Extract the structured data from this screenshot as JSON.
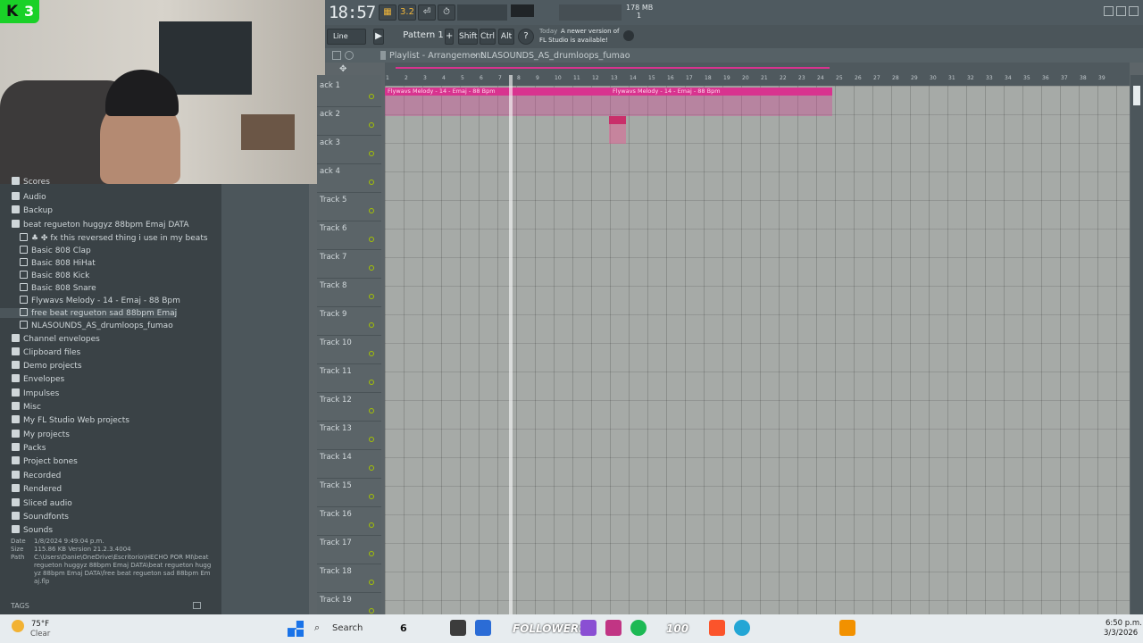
{
  "stream": {
    "badge_letter": "K",
    "badge_count": "3"
  },
  "topbar": {
    "time": "18:57",
    "memory": "178 MB",
    "memory_sub": "1",
    "pattern": "Pattern 1",
    "line_mode": "Line",
    "shift": "Shift",
    "ctrl": "Ctrl",
    "alt": "Alt",
    "notice_today": "Today",
    "notice_text": "A newer version of",
    "notice_text2": "FL Studio is available!"
  },
  "playlist": {
    "title": "Playlist - Arrangement",
    "sep": "›",
    "pattern_name": "NLASOUNDS_AS_drumloops_fumao",
    "ruler": [
      "1",
      "2",
      "3",
      "4",
      "5",
      "6",
      "7",
      "8",
      "9",
      "10",
      "11",
      "12",
      "13",
      "14",
      "15",
      "16",
      "17",
      "18",
      "19",
      "20",
      "21",
      "22",
      "23",
      "24",
      "25",
      "26",
      "27",
      "28",
      "29",
      "30",
      "31",
      "32",
      "33",
      "34",
      "35",
      "36",
      "37",
      "38",
      "39"
    ],
    "tracks": [
      "ack 1",
      "ack 2",
      "ack 3",
      "ack 4",
      "Track 5",
      "Track 6",
      "Track 7",
      "Track 8",
      "Track 9",
      "Track 10",
      "Track 11",
      "Track 12",
      "Track 13",
      "Track 14",
      "Track 15",
      "Track 16",
      "Track 17",
      "Track 18",
      "Track 19"
    ],
    "clip_label": "Flywavs Melody - 14 - Emaj - 88 Bpm"
  },
  "browser": {
    "items": [
      {
        "label": "Scores",
        "sub": false
      },
      {
        "label": "Audio",
        "sub": false
      },
      {
        "label": "Backup",
        "sub": false
      },
      {
        "label": "beat regueton huggyz 88bpm Emaj DATA",
        "sub": false
      },
      {
        "label": "♣ ✤ fx this reversed thing i use in my beats",
        "sub": true
      },
      {
        "label": "Basic 808 Clap",
        "sub": true
      },
      {
        "label": "Basic 808 HiHat",
        "sub": true
      },
      {
        "label": "Basic 808 Kick",
        "sub": true
      },
      {
        "label": "Basic 808 Snare",
        "sub": true
      },
      {
        "label": "Flywavs Melody - 14 - Emaj - 88 Bpm",
        "sub": true
      },
      {
        "label": "free beat regueton sad 88bpm Emaj",
        "sub": true
      },
      {
        "label": "NLASOUNDS_AS_drumloops_fumao",
        "sub": true
      },
      {
        "label": "Channel envelopes",
        "sub": false
      },
      {
        "label": "Clipboard files",
        "sub": false
      },
      {
        "label": "Demo projects",
        "sub": false
      },
      {
        "label": "Envelopes",
        "sub": false
      },
      {
        "label": "Impulses",
        "sub": false
      },
      {
        "label": "Misc",
        "sub": false
      },
      {
        "label": "My FL Studio Web projects",
        "sub": false
      },
      {
        "label": "My projects",
        "sub": false
      },
      {
        "label": "Packs",
        "sub": false
      },
      {
        "label": "Project bones",
        "sub": false
      },
      {
        "label": "Recorded",
        "sub": false
      },
      {
        "label": "Rendered",
        "sub": false
      },
      {
        "label": "Sliced audio",
        "sub": false
      },
      {
        "label": "Soundfonts",
        "sub": false
      },
      {
        "label": "Sounds",
        "sub": false
      }
    ],
    "info_date_label": "Date",
    "info_date": "1/8/2024 9:49:04 p.m.",
    "info_size_label": "Size",
    "info_size": "115.86 KB  Version 21.2.3.4004",
    "info_path_label": "Path",
    "info_path": "C:\\Users\\Danie\\OneDrive\\Escritorio\\HECHO POR MI\\beat regueton huggyz 88bpm Emaj DATA\\beat regueton huggyz 88bpm Emaj DATA\\free beat regueton sad 88bpm Emaj.flp",
    "tags": "TAGS"
  },
  "taskbar": {
    "temp": "75°F",
    "weather": "Clear",
    "search": "Search",
    "followers": "FOLLOWERS",
    "num6": "6",
    "num100": "100",
    "time": "6:50 p.m.",
    "date": "3/3/2026"
  }
}
